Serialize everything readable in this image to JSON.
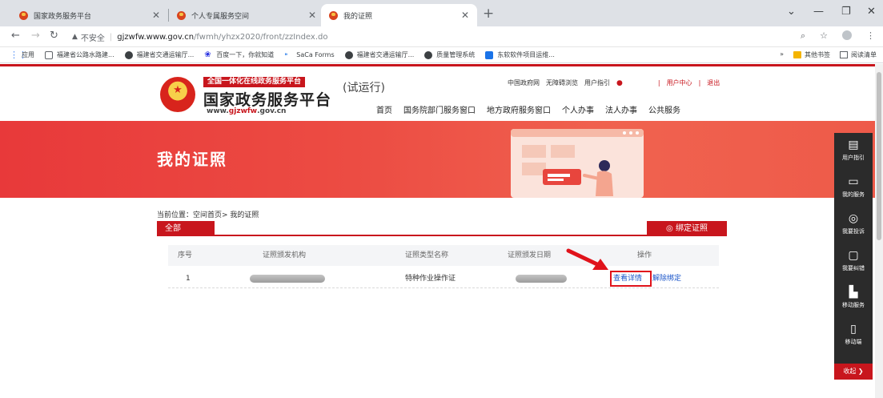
{
  "browser": {
    "tabs": [
      {
        "title": "国家政务服务平台",
        "active": false
      },
      {
        "title": "个人专属服务空间",
        "active": false
      },
      {
        "title": "我的证照",
        "active": true
      }
    ],
    "address": {
      "insecure_label": "不安全",
      "host": "gjzwfw.www.gov.cn",
      "path": "/fwmh/yhzx2020/front/zzIndex.do"
    },
    "bookmarks": [
      {
        "label": "应用",
        "color": "#4285f4"
      },
      {
        "label": "福建省公路水路建...",
        "color": "#5f6368"
      },
      {
        "label": "福建省交通运输厅...",
        "color": "#3c4043"
      },
      {
        "label": "百度一下，你就知道",
        "color": "#2932e1"
      },
      {
        "label": "SaCa Forms",
        "color": "#1a73e8"
      },
      {
        "label": "福建省交通运输厅...",
        "color": "#3c4043"
      },
      {
        "label": "质量管理系统",
        "color": "#3c4043"
      },
      {
        "label": "东软软件项目运维...",
        "color": "#1a73e8"
      }
    ],
    "bookmarks_more": "»",
    "other_bookmarks": "其他书签",
    "reading_list": "阅读清单"
  },
  "site": {
    "banner_tag": "全国一体化在线政务服务平台",
    "name": "国家政务服务平台",
    "url_prefix": "www.",
    "url_domain": "gjzwfw",
    "url_suffix": ".gov.cn",
    "trial": "(试运行)",
    "toplinks": {
      "gov": "中国政府网",
      "barrier_free": "无障碍浏览",
      "guide": "用户指引",
      "user_center": "用户中心",
      "logout": "退出"
    },
    "nav": [
      "首页",
      "国务院部门服务窗口",
      "地方政府服务窗口",
      "个人办事",
      "法人办事",
      "公共服务"
    ]
  },
  "hero": {
    "title": "我的证照"
  },
  "breadcrumb": "当前位置：空间首页> 我的证照",
  "filter_tab": "全部",
  "bind_button": "◎ 绑定证照",
  "table": {
    "headers": [
      "序号",
      "证照颁发机构",
      "证照类型名称",
      "证照颁发日期",
      "操作"
    ],
    "rows": [
      {
        "index": "1",
        "type_name": "特种作业操作证",
        "view": "查看详情",
        "unbind": "解除绑定"
      }
    ]
  },
  "sidebar": [
    {
      "label": "用户指引",
      "icon": "guide-icon"
    },
    {
      "label": "我的服务",
      "icon": "service-icon"
    },
    {
      "label": "我要投诉",
      "icon": "complaint-icon"
    },
    {
      "label": "我要纠错",
      "icon": "correction-icon"
    },
    {
      "label": "移动服务",
      "icon": "mobile-service-icon"
    },
    {
      "label": "移动端",
      "icon": "mobile-icon"
    }
  ],
  "sidebar_fold": "收起 ❯",
  "colors": {
    "brand_red": "#c8161d",
    "link_blue": "#1a55c9",
    "annotation_red": "#e0131b"
  }
}
